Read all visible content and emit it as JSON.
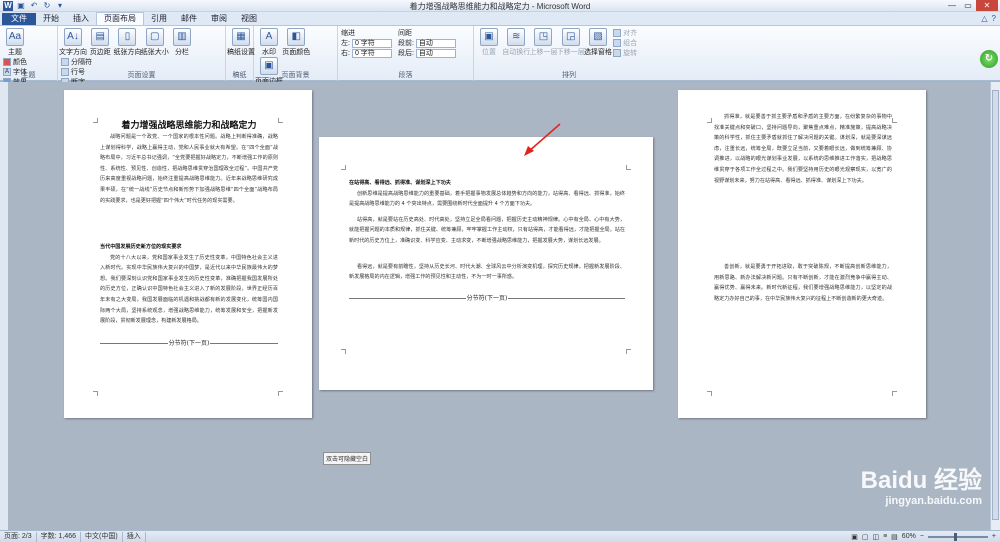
{
  "window": {
    "title": "着力增强战略思维能力和战略定力 - Microsoft Word"
  },
  "tabs": [
    "文件",
    "开始",
    "插入",
    "页面布局",
    "引用",
    "邮件",
    "审阅",
    "视图"
  ],
  "ribbon": {
    "themes": {
      "label": "主题",
      "big": "主题",
      "colors": "颜色",
      "fonts": "字体",
      "effects": "效果"
    },
    "page_setup": {
      "label": "页面设置",
      "buttons": [
        "文字方向",
        "页边距",
        "纸张方向",
        "纸张大小",
        "分栏"
      ],
      "small": [
        "分隔符",
        "行号",
        "断字"
      ]
    },
    "manuscript": {
      "label": "稿纸",
      "button": "稿纸设置"
    },
    "page_bg": {
      "label": "页面背景",
      "buttons": [
        "水印",
        "页面颜色",
        "页面边框"
      ]
    },
    "paragraph": {
      "label": "段落",
      "indent": "缩进",
      "spacing": "间距",
      "left": "左:",
      "right": "右:",
      "before": "段前:",
      "after": "段后:",
      "left_val": "0 字符",
      "right_val": "0 字符",
      "before_val": "自动",
      "after_val": "自动"
    },
    "arrange": {
      "label": "排列",
      "buttons": [
        "位置",
        "自动换行",
        "上移一层",
        "下移一层",
        "选择窗格"
      ],
      "small": [
        "对齐",
        "组合",
        "旋转"
      ]
    }
  },
  "pages": {
    "p1": {
      "title": "着力增强战略思维能力和战略定力",
      "para1": "战略问题是一个政党、一个国家的根本性问题。战略上判断得准确，战略上谋划得科学，战略上赢得主动，党和人民事业就大有希望。在“四个全面”战略布局中，习近平总书记强调，“全党要把握好战略定力，不断增强工作的原则性、系统性、预见性、创造性，把战略思维贯穿治国理政全过程”。中国共产党历来高度重视战略问题，始终注重提高战略思维能力。近年来战略思维研究成果丰硕，在“统一战线”历史节点和新形势下加强战略思维“四个全面”战略布局的实践要求，也是更好把握“四个伟大”时代任务的现实需要。",
      "heading": "当代中国发展历史新方位的现实要求",
      "para2": "党的十八大以来，党和国家事业发生了历史性变革，中国特色社会主义进入新时代。实现中华民族伟大复兴的中国梦，是近代以来中华民族最伟大的梦想。我们要深刻认识党和国家事业发生的历史性变革，准确把握我国发展所处的历史方位，正确认识中国特色社会主义进入了新的发展阶段，世界正经历百年未有之大变局，我国发展面临的机遇和挑战都有新的发展变化，统筹国内国际两个大局，坚持系统观念，增强战略思维能力，统筹发展和安全，把握新发展阶段，贯彻新发展理念，构建新发展格局。",
      "section": "分节符(下一页)"
    },
    "p2": {
      "heading": "在站得高、看得远、抓得准、谋划深上下功夫",
      "para1": "创新思维是提高战略思维能力的重要基础，着手把握事物发展总体趋势和方向的能力，站得高、看得远、抓得准，始终是提高战略思维能力的 4 个突出特点，需要围绕新时代全面提升 4 个方面下功夫。",
      "para2": "站得高，就是要站在历史高处、时代高处，坚持立足全局看问题，把握历史主动精神规律。心中有全局、心中有大势，就能把握问题的本质和规律，抓住关键、统筹兼顾，牢牢掌握工作主动权，只有站得高，才能看得远，才能把握全局。站在新时代的历史方位上，准确识变、科学应变、主动求变，不断增强战略思维能力，把握发展大势，谋划长远发展。",
      "para3": "看得远，就是要有前瞻性，坚持从历史长河、时代大潮、全球风云中分析演变机理，探究历史规律，把握新发展阶段、新发展格局的内在逻辑，增强工作的预见性和主动性，不为一时一事所惑。",
      "section": "分节符(下一页)"
    },
    "p3": {
      "para1": "抓得准，就是要善于抓主要矛盾和矛盾的主要方面，在纷繁复杂的事物中找准关键点和突破口，坚持问题导向，聚焦重点难点，精准施策，提高战略决策的科学性，抓住主要矛盾就抓住了解决问题的关键。谋划深，就是要深谋远虑，注重长远，统筹全局，既要立足当前，又要着眼长远，做到统筹兼顾、协调推进，以战略的眼光谋划事业发展，以系统的思维推进工作落实，把战略思维贯穿于各项工作全过程之中。我们要坚持用历史的眼光观察现实，以宽广的视野谋划未来，努力在站得高、看得远、抓得准、谋划深上下功夫。",
      "para2": "善创新，就是要勇于开拓进取，敢于突破陈规，不断提高创新思维能力，用新思路、新办法解决新问题。只有不断创新，才能在激烈竞争中赢得主动、赢得优势、赢得未来。新时代新征程，我们要增强战略思维能力，以坚定的战略定力办好自己的事，在中华民族伟大复兴的征程上不断创造新的更大奇迹。"
    }
  },
  "tooltip": "双击可隐藏空白",
  "status": {
    "page": "页面: 2/3",
    "words": "字数: 1,466",
    "language": "中文(中国)",
    "mode": "插入",
    "zoom": "60%"
  },
  "watermark": {
    "brand": "Baidu 经验",
    "url": "jingyan.baidu.com"
  }
}
